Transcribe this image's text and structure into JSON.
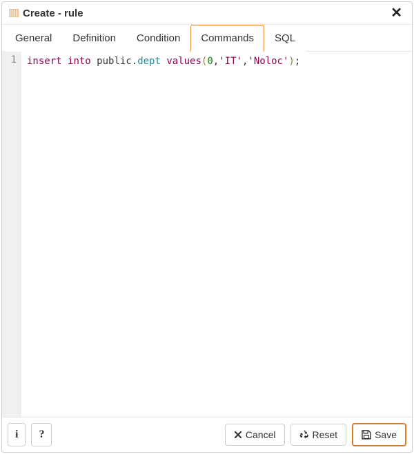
{
  "dialog": {
    "title": "Create - rule",
    "close_label": "✕"
  },
  "tabs": [
    {
      "label": "General",
      "active": false
    },
    {
      "label": "Definition",
      "active": false
    },
    {
      "label": "Condition",
      "active": false
    },
    {
      "label": "Commands",
      "active": true
    },
    {
      "label": "SQL",
      "active": false
    }
  ],
  "editor": {
    "line_number": "1",
    "tokens": {
      "insert": "insert",
      "into": "into",
      "public": "public",
      "dot": ".",
      "dept": "dept",
      "values": "values",
      "lparen": "(",
      "num0": "0",
      "comma1": ",",
      "str1": "'IT'",
      "comma2": ",",
      "str2": "'Noloc'",
      "rparen": ")",
      "semi": ";"
    }
  },
  "footer": {
    "info_label": "i",
    "help_label": "?",
    "cancel_label": "Cancel",
    "reset_label": "Reset",
    "save_label": "Save"
  }
}
